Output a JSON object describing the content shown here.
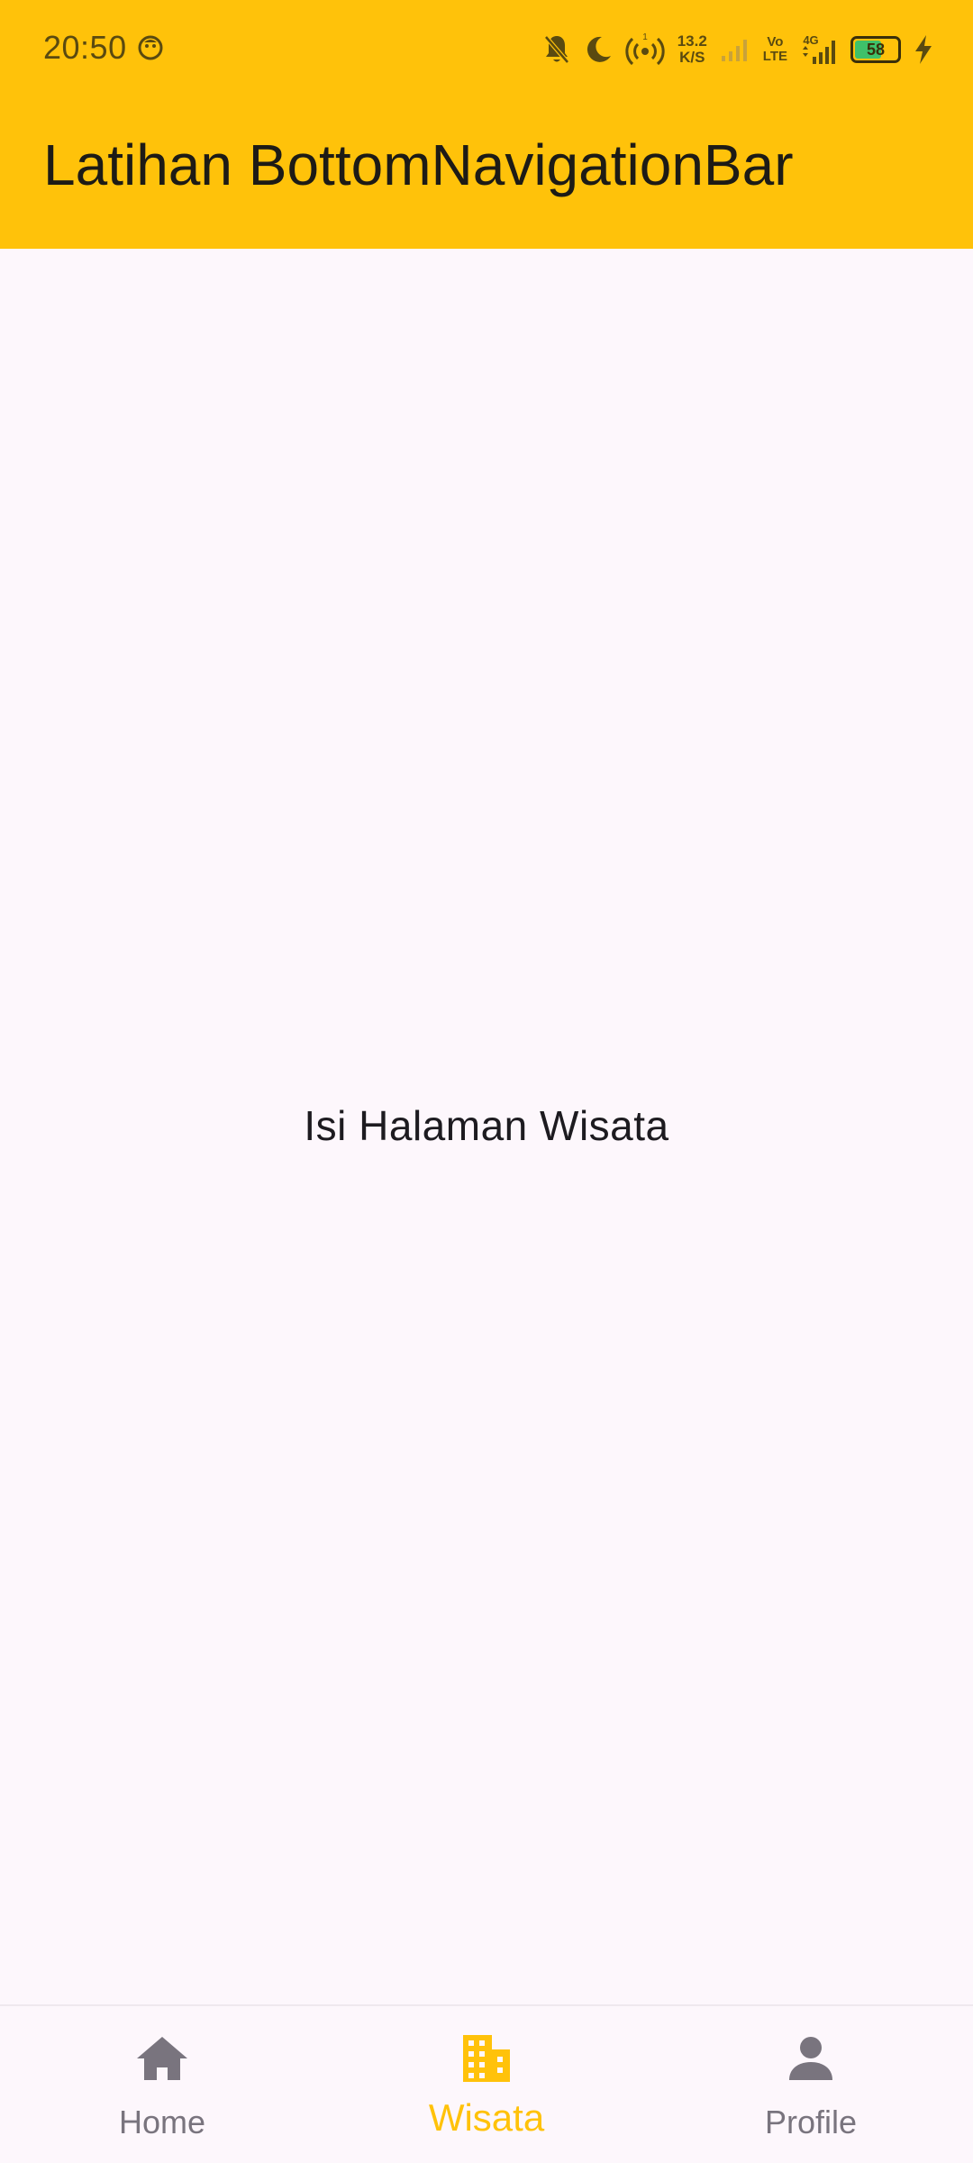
{
  "status_bar": {
    "time": "20:50",
    "speed_value": "13.2",
    "speed_unit": "K/S",
    "volte_top": "Vo",
    "volte_bottom": "LTE",
    "network": "4G",
    "battery_level": "58",
    "hotspot_badge": "1"
  },
  "app_bar": {
    "title": "Latihan BottomNavigationBar"
  },
  "content": {
    "text": "Isi Halaman Wisata"
  },
  "bottom_nav": {
    "items": [
      {
        "label": "Home",
        "icon": "home-icon",
        "active": false
      },
      {
        "label": "Wisata",
        "icon": "apartment-icon",
        "active": true
      },
      {
        "label": "Profile",
        "icon": "person-icon",
        "active": false
      }
    ]
  },
  "colors": {
    "app_bar": "#ffc20a",
    "background": "#fdf7fc",
    "active": "#ffc20a",
    "inactive": "#79747e"
  }
}
